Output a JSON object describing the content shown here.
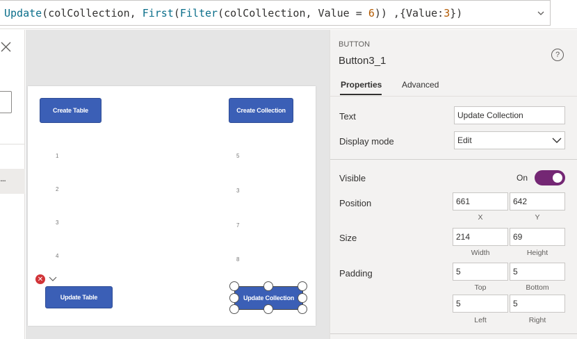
{
  "formula": {
    "tokens": [
      {
        "text": "Update",
        "kind": "fn"
      },
      {
        "text": "(colCollection, ",
        "kind": "plain"
      },
      {
        "text": "First",
        "kind": "fn"
      },
      {
        "text": "(",
        "kind": "plain"
      },
      {
        "text": "Filter",
        "kind": "fn"
      },
      {
        "text": "(colCollection, Value = ",
        "kind": "plain"
      },
      {
        "text": "6",
        "kind": "num"
      },
      {
        "text": ")) ,{Value:",
        "kind": "plain"
      },
      {
        "text": "3",
        "kind": "num"
      },
      {
        "text": "})",
        "kind": "plain"
      }
    ],
    "expand_icon": "chevron-down-icon"
  },
  "left_panel": {
    "close_icon": "close-icon",
    "selected_item_ellipsis": "..."
  },
  "canvas": {
    "buttons": {
      "create_table": "Create Table",
      "create_collection": "Create Collection",
      "update_table": "Update Table",
      "update_collection": "Update Collection"
    },
    "table_gallery": [
      "1",
      "2",
      "3",
      "4"
    ],
    "collection_gallery": [
      "5",
      "3",
      "7",
      "8"
    ],
    "error_glyph": "✕"
  },
  "properties": {
    "control_type": "BUTTON",
    "control_name": "Button3_1",
    "help_glyph": "?",
    "tabs": [
      "Properties",
      "Advanced"
    ],
    "text_label": "Text",
    "text_value": "Update Collection",
    "display_mode_label": "Display mode",
    "display_mode_value": "Edit",
    "visible_label": "Visible",
    "visible_state": "On",
    "position_label": "Position",
    "position_x": "661",
    "position_y": "642",
    "x_label": "X",
    "y_label": "Y",
    "size_label": "Size",
    "width_value": "214",
    "height_value": "69",
    "width_label": "Width",
    "height_label": "Height",
    "padding_label": "Padding",
    "padding_top": "5",
    "padding_bottom": "5",
    "padding_left": "5",
    "padding_right": "5",
    "top_label": "Top",
    "bottom_label": "Bottom",
    "left_label": "Left",
    "right_label": "Right"
  },
  "colors": {
    "button_blue": "#3b5fb6",
    "toggle_purple": "#742774",
    "error_red": "#d13438"
  }
}
